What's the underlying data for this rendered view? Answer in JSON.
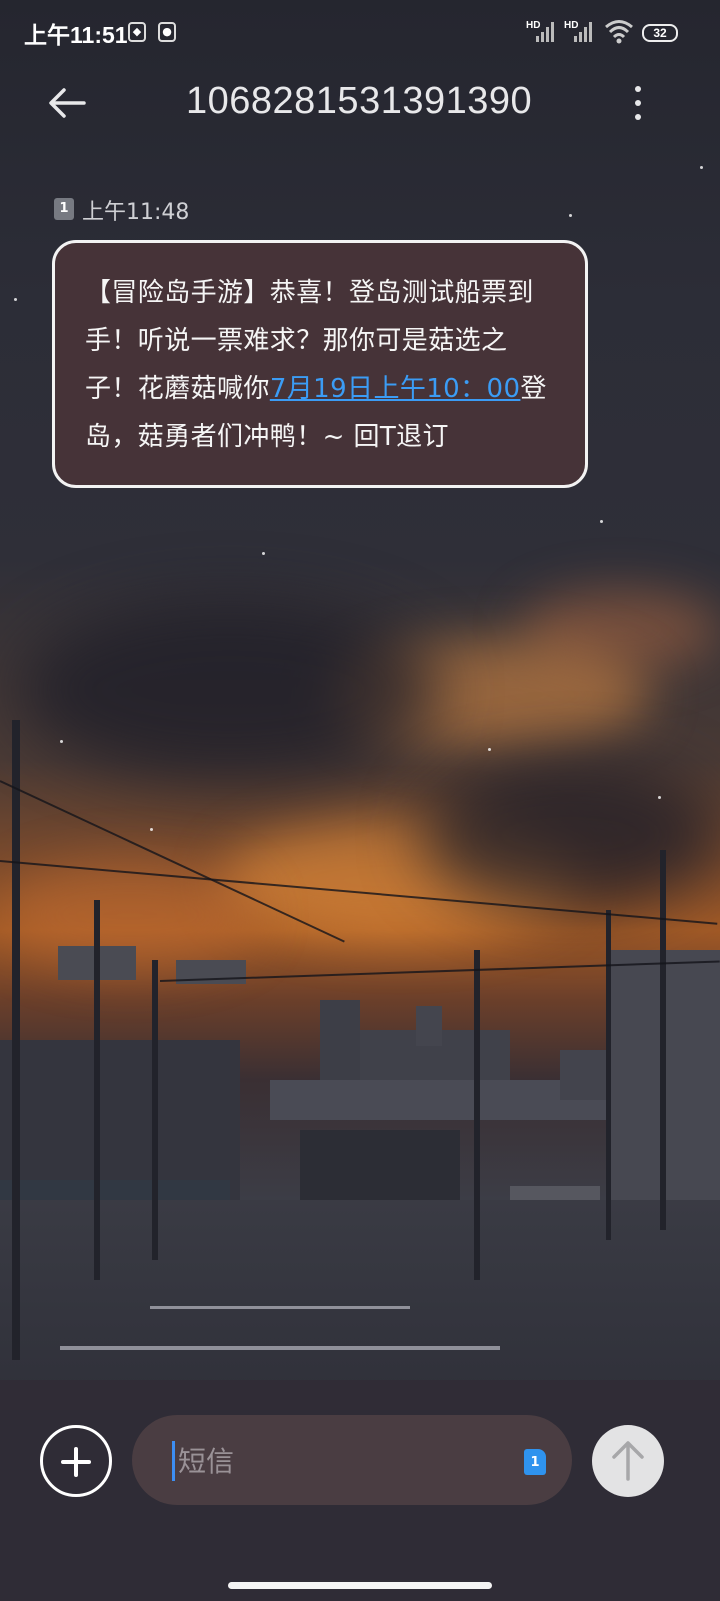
{
  "status_bar": {
    "time": "上午11:51",
    "network_1": "HD",
    "network_2": "HD",
    "battery": "32"
  },
  "header": {
    "title": "1068281531391390",
    "back_icon": "arrow-left-icon",
    "menu_icon": "more-vertical-icon"
  },
  "message": {
    "sim": "1",
    "time": "上午11:48",
    "text_before_link": "【冒险岛手游】恭喜！登岛测试船票到手！听说一票难求？那你可是菇选之子！花蘑菇喊你",
    "link_text": "7月19日上午10：00",
    "text_after_link": "登岛，菇勇者们冲鸭！~ 回T退订"
  },
  "composer": {
    "placeholder": "短信",
    "sim": "1",
    "add_icon": "plus-icon",
    "send_icon": "arrow-up-icon"
  },
  "colors": {
    "link": "#3b9cf5",
    "bubble_bg": "#483438",
    "sim_pick": "#2f93ee"
  }
}
